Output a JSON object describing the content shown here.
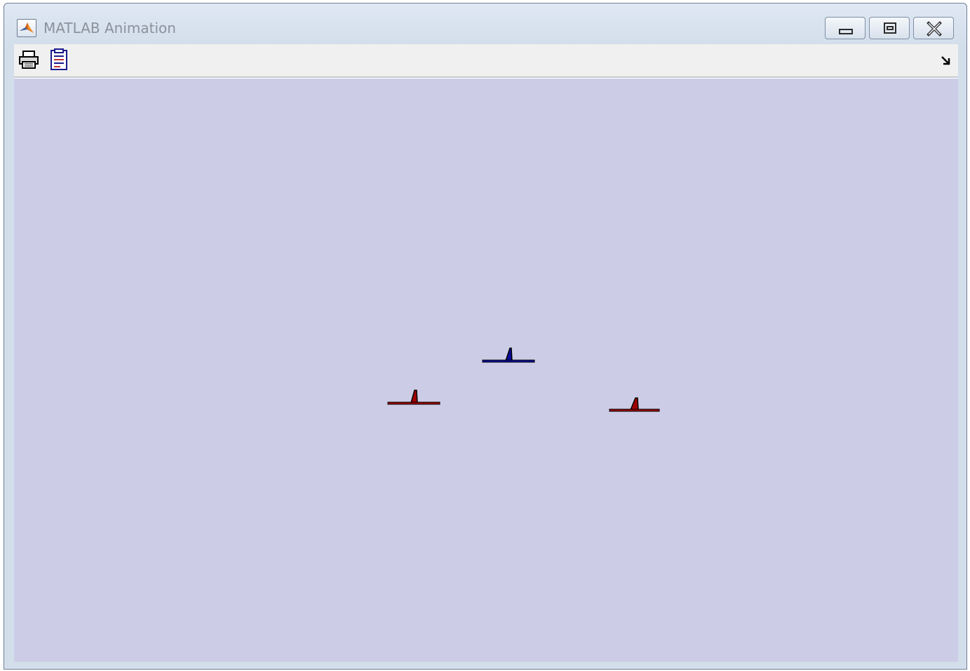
{
  "window": {
    "title": "MATLAB Animation",
    "buttons": {
      "minimize": "minimize-icon",
      "maximize": "maximize-icon",
      "close": "close-icon"
    }
  },
  "toolbar": {
    "items": [
      "print-icon",
      "edit-figure-icon"
    ],
    "dock": "dock-arrow-icon"
  },
  "figure": {
    "background": "#ccccE6",
    "aircraft": [
      {
        "name": "blue",
        "color": "#0a0a9a"
      },
      {
        "name": "red-left",
        "color": "#a00000"
      },
      {
        "name": "red-right",
        "color": "#a00000"
      }
    ]
  }
}
